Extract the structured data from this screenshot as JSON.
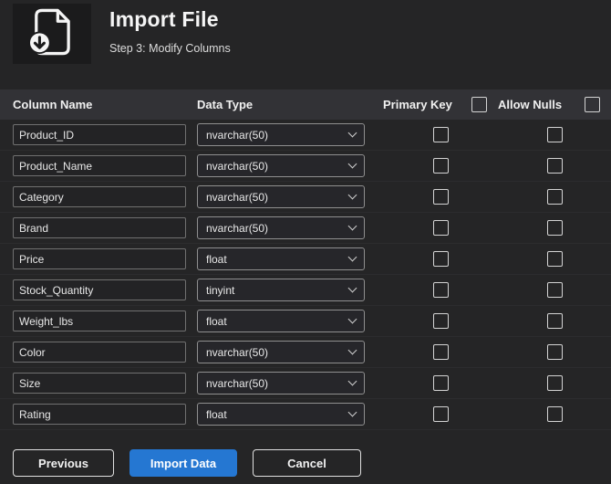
{
  "header": {
    "title": "Import File",
    "subtitle": "Step 3: Modify Columns"
  },
  "table": {
    "headers": {
      "column_name": "Column Name",
      "data_type": "Data Type",
      "primary_key": "Primary Key",
      "allow_nulls": "Allow Nulls"
    },
    "rows": [
      {
        "name": "Product_ID",
        "type": "nvarchar(50)",
        "primary_key": false,
        "allow_nulls": false
      },
      {
        "name": "Product_Name",
        "type": "nvarchar(50)",
        "primary_key": false,
        "allow_nulls": false
      },
      {
        "name": "Category",
        "type": "nvarchar(50)",
        "primary_key": false,
        "allow_nulls": false
      },
      {
        "name": "Brand",
        "type": "nvarchar(50)",
        "primary_key": false,
        "allow_nulls": false
      },
      {
        "name": "Price",
        "type": "float",
        "primary_key": false,
        "allow_nulls": false
      },
      {
        "name": "Stock_Quantity",
        "type": "tinyint",
        "primary_key": false,
        "allow_nulls": false
      },
      {
        "name": "Weight_lbs",
        "type": "float",
        "primary_key": false,
        "allow_nulls": false
      },
      {
        "name": "Color",
        "type": "nvarchar(50)",
        "primary_key": false,
        "allow_nulls": false
      },
      {
        "name": "Size",
        "type": "nvarchar(50)",
        "primary_key": false,
        "allow_nulls": false
      },
      {
        "name": "Rating",
        "type": "float",
        "primary_key": false,
        "allow_nulls": false
      }
    ]
  },
  "footer": {
    "previous": "Previous",
    "import": "Import Data",
    "cancel": "Cancel"
  },
  "colors": {
    "accent": "#2577d2",
    "background": "#252526",
    "table_header_bg": "#323236"
  }
}
